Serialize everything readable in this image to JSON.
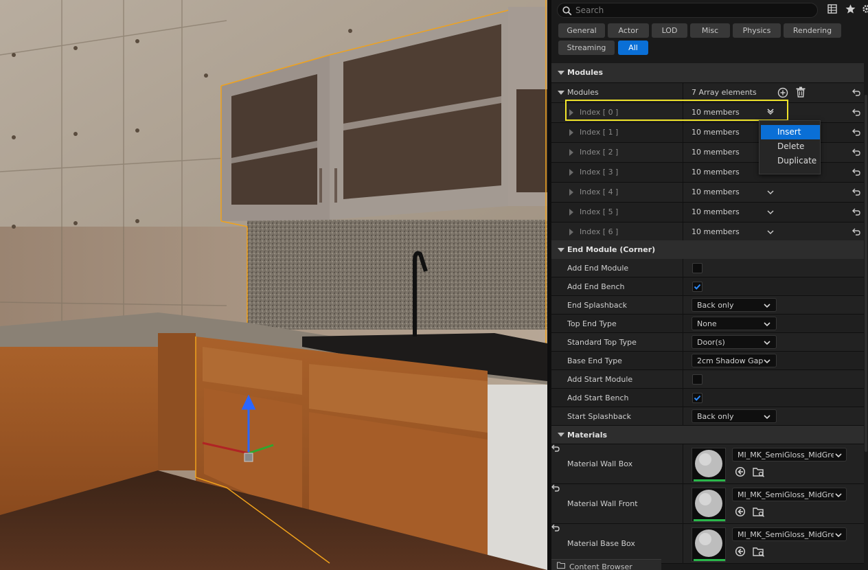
{
  "search": {
    "placeholder": "Search"
  },
  "toolbar_icons": [
    "table-view-icon",
    "star-icon",
    "settings-icon"
  ],
  "filters": [
    {
      "label": "General",
      "active": false
    },
    {
      "label": "Actor",
      "active": false
    },
    {
      "label": "LOD",
      "active": false
    },
    {
      "label": "Misc",
      "active": false
    },
    {
      "label": "Physics",
      "active": false
    },
    {
      "label": "Rendering",
      "active": false
    },
    {
      "label": "Streaming",
      "active": false
    },
    {
      "label": "All",
      "active": true
    }
  ],
  "modules": {
    "category": "Modules",
    "array_label": "Modules",
    "array_value": "7 Array elements",
    "items": [
      {
        "label": "Index [ 0 ]",
        "value": "10 members"
      },
      {
        "label": "Index [ 1 ]",
        "value": "10 members"
      },
      {
        "label": "Index [ 2 ]",
        "value": "10 members"
      },
      {
        "label": "Index [ 3 ]",
        "value": "10 members"
      },
      {
        "label": "Index [ 4 ]",
        "value": "10 members"
      },
      {
        "label": "Index [ 5 ]",
        "value": "10 members"
      },
      {
        "label": "Index [ 6 ]",
        "value": "10 members"
      }
    ]
  },
  "context_menu": {
    "items": [
      "Insert",
      "Delete",
      "Duplicate"
    ],
    "selected": "Insert"
  },
  "end_module": {
    "category": "End Module (Corner)",
    "props": [
      {
        "label": "Add End Module",
        "type": "checkbox",
        "checked": false
      },
      {
        "label": "Add End Bench",
        "type": "checkbox",
        "checked": true
      },
      {
        "label": "End Splashback",
        "type": "combo",
        "value": "Back only"
      },
      {
        "label": "Top End Type",
        "type": "combo",
        "value": "None"
      },
      {
        "label": "Standard Top Type",
        "type": "combo",
        "value": "Door(s)"
      },
      {
        "label": "Base End Type",
        "type": "combo",
        "value": "2cm Shadow Gap"
      },
      {
        "label": "Add Start Module",
        "type": "checkbox",
        "checked": false
      },
      {
        "label": "Add Start Bench",
        "type": "checkbox",
        "checked": true
      },
      {
        "label": "Start Splashback",
        "type": "combo",
        "value": "Back only"
      }
    ]
  },
  "materials": {
    "category": "Materials",
    "items": [
      {
        "label": "Material Wall Box",
        "value": "MI_MK_SemiGloss_MidGre"
      },
      {
        "label": "Material Wall Front",
        "value": "MI_MK_SemiGloss_MidGre"
      },
      {
        "label": "Material Base Box",
        "value": "MI_MK_SemiGloss_MidGre"
      }
    ]
  },
  "bottom_tab": {
    "label": "Content Browser"
  },
  "colors": {
    "accent": "#0a6fd6",
    "highlight": "#f1e52a",
    "selection_outline": "#f0a21c"
  }
}
